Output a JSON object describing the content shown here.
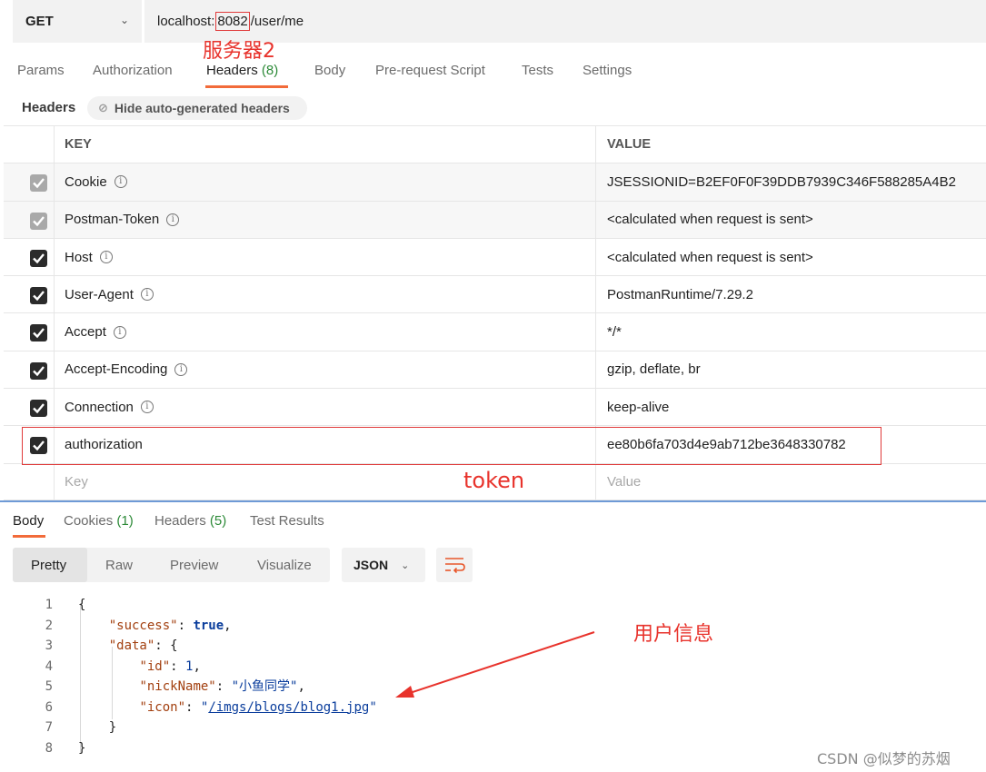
{
  "request": {
    "method": "GET",
    "url_prefix": "localhost:",
    "url_port": "8082",
    "url_path": "/user/me"
  },
  "annotations": {
    "server": "服务器2",
    "token": "token",
    "user_info": "用户信息"
  },
  "request_tabs": [
    {
      "label": "Params"
    },
    {
      "label": "Authorization"
    },
    {
      "label": "Headers",
      "count": "(8)"
    },
    {
      "label": "Body"
    },
    {
      "label": "Pre-request Script"
    },
    {
      "label": "Tests"
    },
    {
      "label": "Settings"
    }
  ],
  "headers_section": {
    "label": "Headers",
    "hide_auto_label": "Hide auto-generated headers"
  },
  "table": {
    "key_header": "KEY",
    "value_header": "VALUE",
    "rows": [
      {
        "key": "Cookie",
        "value": "JSESSIONID=B2EF0F0F39DDB7939C346F588285A4B2"
      },
      {
        "key": "Postman-Token",
        "value": "<calculated when request is sent>"
      },
      {
        "key": "Host",
        "value": "<calculated when request is sent>"
      },
      {
        "key": "User-Agent",
        "value": "PostmanRuntime/7.29.2"
      },
      {
        "key": "Accept",
        "value": "*/*"
      },
      {
        "key": "Accept-Encoding",
        "value": "gzip, deflate, br"
      },
      {
        "key": "Connection",
        "value": "keep-alive"
      },
      {
        "key": "authorization",
        "value": "ee80b6fa703d4e9ab712be3648330782"
      }
    ],
    "key_placeholder": "Key",
    "value_placeholder": "Value"
  },
  "response_tabs": [
    {
      "label": "Body"
    },
    {
      "label": "Cookies",
      "count": "(1)"
    },
    {
      "label": "Headers",
      "count": "(5)"
    },
    {
      "label": "Test Results"
    }
  ],
  "view_modes": [
    "Pretty",
    "Raw",
    "Preview",
    "Visualize"
  ],
  "format": "JSON",
  "code": {
    "line_numbers": [
      "1",
      "2",
      "3",
      "4",
      "5",
      "6",
      "7",
      "8"
    ],
    "success_key": "\"success\"",
    "success_value": "true",
    "data_key": "\"data\"",
    "id_key": "\"id\"",
    "id_value": "1",
    "nickname_key": "\"nickName\"",
    "nickname_value": "\"小鱼同学\"",
    "icon_key": "\"icon\"",
    "icon_value": "/imgs/blogs/blog1.jpg"
  },
  "watermark": "CSDN @似梦的苏烟"
}
